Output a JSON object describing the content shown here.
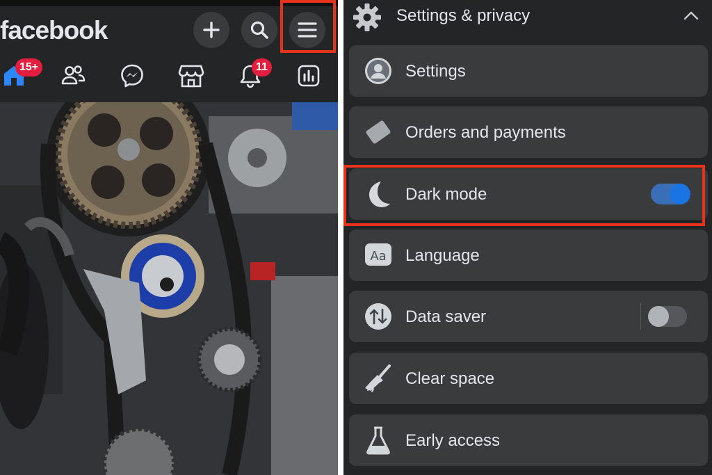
{
  "left_panel": {
    "logo": "facebook",
    "header_buttons": [
      {
        "name": "create-button",
        "icon": "plus-icon"
      },
      {
        "name": "search-button",
        "icon": "search-icon"
      },
      {
        "name": "menu-button",
        "icon": "hamburger-menu-icon",
        "highlighted": true
      }
    ],
    "nav": [
      {
        "name": "home",
        "icon": "home-icon",
        "badge": "15+"
      },
      {
        "name": "friends",
        "icon": "friends-icon",
        "badge": ""
      },
      {
        "name": "messenger",
        "icon": "messenger-icon",
        "badge": ""
      },
      {
        "name": "marketplace",
        "icon": "marketplace-icon",
        "badge": ""
      },
      {
        "name": "notifications",
        "icon": "bell-icon",
        "badge": "11"
      },
      {
        "name": "dashboard",
        "icon": "chart-icon",
        "badge": ""
      }
    ],
    "feed_image": "engine-timing-belt-photo"
  },
  "right_panel": {
    "section_title": "Settings & privacy",
    "section_icon": "gear-icon",
    "collapse_icon": "chevron-up-icon",
    "items": [
      {
        "label": "Settings",
        "icon": "account-icon"
      },
      {
        "label": "Orders and payments",
        "icon": "card-icon"
      },
      {
        "label": "Dark mode",
        "icon": "moon-icon",
        "toggle": "on",
        "highlighted": true
      },
      {
        "label": "Language",
        "icon": "language-icon"
      },
      {
        "label": "Data saver",
        "icon": "data-saver-icon",
        "toggle": "off"
      },
      {
        "label": "Clear space",
        "icon": "broom-icon"
      },
      {
        "label": "Early access",
        "icon": "flask-icon"
      }
    ]
  },
  "colors": {
    "background": "#242526",
    "item_background": "#3a3b3c",
    "text": "#e4e6eb",
    "accent_blue": "#1b74e4",
    "badge_red": "#e41e3f",
    "highlight_outline": "#e8321c"
  }
}
